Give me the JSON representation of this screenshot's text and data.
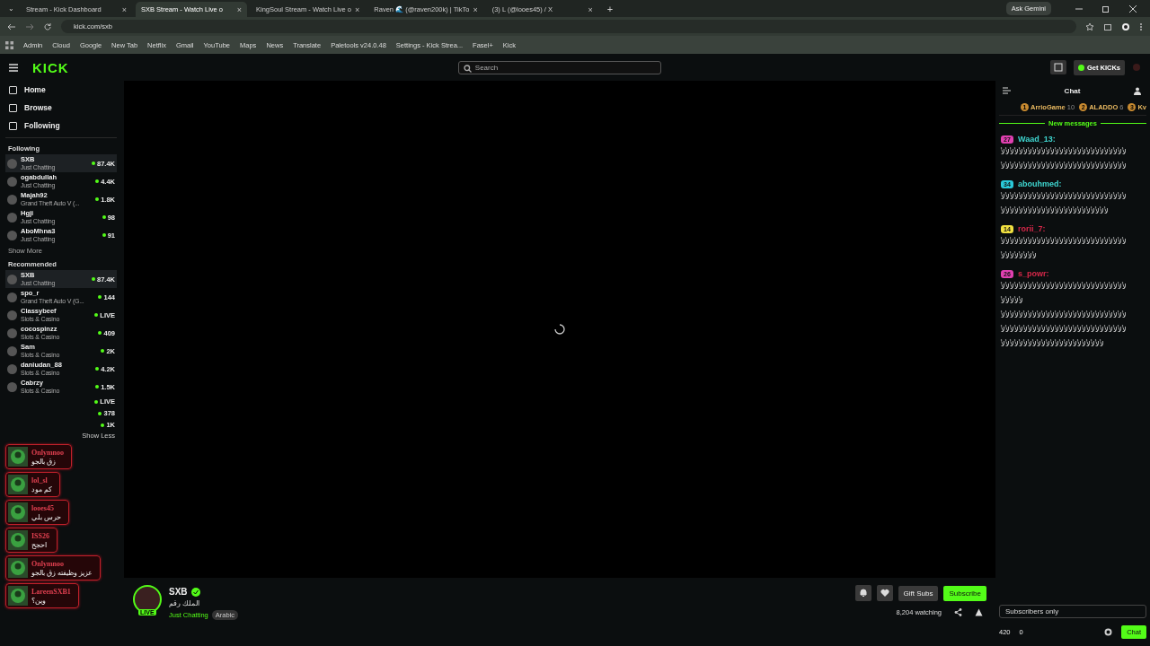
{
  "browser": {
    "tab_list": "⌄",
    "tabs": [
      {
        "title": "Stream - Kick Dashboard",
        "close": "×",
        "selected": false
      },
      {
        "title": "SXB Stream - Watch Live o",
        "close": "×",
        "selected": true
      },
      {
        "title": "KingSoul Stream - Watch Live o",
        "close": "×",
        "selected": false
      },
      {
        "title": "Raven 🌊 (@raven200k) | TikTo",
        "close": "×",
        "selected": false
      },
      {
        "title": "(3) L (@looes45) / X",
        "close": "×",
        "selected": false
      }
    ],
    "new_tab": "+",
    "ask": "Ask Gemini",
    "url": "kick.com/sxb",
    "bookmarks": [
      "Admin",
      "Cloud",
      "Google",
      "New Tab",
      "Netflix",
      "Gmail",
      "YouTube",
      "Maps",
      "News",
      "Translate",
      "Paletools v24.0.48",
      "Settings - Kick Strea...",
      "Fasel+",
      "Kick"
    ]
  },
  "header": {
    "logo": "KICK",
    "search_placeholder": "Search",
    "get_kicks": "Get KICKs"
  },
  "nav": [
    "Home",
    "Browse",
    "Following"
  ],
  "following": {
    "title": "Following",
    "channels": [
      {
        "name": "SXB",
        "category": "Just Chatting",
        "viewers": "87.4K",
        "selected": true
      },
      {
        "name": "ogabdullah",
        "category": "Just Chatting",
        "viewers": "4.4K",
        "selected": false
      },
      {
        "name": "Majah92",
        "category": "Grand Theft Auto V (...",
        "viewers": "1.8K",
        "selected": false
      },
      {
        "name": "Hgji",
        "category": "Just Chatting",
        "viewers": "98",
        "selected": false
      },
      {
        "name": "AboMhna3",
        "category": "Just Chatting",
        "viewers": "91",
        "selected": false
      }
    ],
    "show_more": "Show More"
  },
  "recommended": {
    "title": "Recommended",
    "channels": [
      {
        "name": "SXB",
        "category": "Just Chatting",
        "viewers": "87.4K",
        "selected": true
      },
      {
        "name": "spo_r",
        "category": "Grand Theft Auto V (G...",
        "viewers": "144",
        "selected": false
      },
      {
        "name": "Classybeef",
        "category": "Slots & Casino",
        "viewers": "LIVE",
        "selected": false
      },
      {
        "name": "cocospinzz",
        "category": "Slots & Casino",
        "viewers": "409",
        "selected": false
      },
      {
        "name": "Sam",
        "category": "Slots & Casino",
        "viewers": "2K",
        "selected": false
      },
      {
        "name": "daniudan_88",
        "category": "Slots & Casino",
        "viewers": "4.2K",
        "selected": false
      },
      {
        "name": "Cabrzy",
        "category": "Slots & Casino",
        "viewers": "1.5K",
        "selected": false
      }
    ],
    "covered_viewers": [
      "LIVE",
      "378",
      "1K"
    ],
    "show_less": "Show Less"
  },
  "notifications": [
    {
      "name": "Onlymnoo",
      "message": "زق بالجو"
    },
    {
      "name": "lol_sl",
      "message": "كم مود"
    },
    {
      "name": "looes45",
      "message": "حرس بلي"
    },
    {
      "name": "ISS26",
      "message": "احجح"
    },
    {
      "name": "Onlymnoo",
      "message": "عزيز وظيفته زق بالجو"
    },
    {
      "name": "LareenSXB1",
      "message": "وين؟"
    }
  ],
  "chat": {
    "title": "Chat",
    "leaders": [
      {
        "rank": "1",
        "name": "ArrioGame",
        "count": "10"
      },
      {
        "rank": "2",
        "name": "ALADDO",
        "count": "6"
      },
      {
        "rank": "3",
        "name": "Kv"
      }
    ],
    "new_messages": "New messages",
    "messages": [
      {
        "badge": {
          "text": "27",
          "color": "#e040b0"
        },
        "user": {
          "name": "Waad_13:",
          "color": "#3fd6d0"
        },
        "lines": [
          "ﻷﻷﻷﻷﻷﻷﻷﻷﻷﻷﻷﻷﻷﻷﻷﻷﻷﻷﻷﻷﻷﻷﻷﻷﻷﻷﻷﻷ",
          "ﻷﻷﻷﻷﻷﻷﻷﻷﻷﻷﻷﻷﻷﻷﻷﻷﻷﻷﻷﻷﻷﻷﻷﻷﻷﻷﻷﻷ"
        ]
      },
      {
        "badge": {
          "text": "34",
          "color": "#2ac8d8"
        },
        "user": {
          "name": "abouhmed:",
          "color": "#3fd6d0"
        },
        "lines": [
          "ﻷﻷﻷﻷﻷﻷﻷﻷﻷﻷﻷﻷﻷﻷﻷﻷﻷﻷﻷﻷﻷﻷﻷﻷﻷﻷﻷﻷ",
          "ﻷﻷﻷﻷﻷﻷﻷﻷﻷﻷﻷﻷﻷﻷﻷﻷﻷﻷﻷﻷﻷﻷﻷﻷ"
        ]
      },
      {
        "badge": {
          "text": "14",
          "color": "#f0e040"
        },
        "user": {
          "name": "rorii_7:",
          "color": "#d8284a"
        },
        "lines": [
          "ﻷﻷﻷﻷﻷﻷﻷﻷﻷﻷﻷﻷﻷﻷﻷﻷﻷﻷﻷﻷﻷﻷﻷﻷﻷﻷﻷﻷ",
          "ﻷﻷﻷﻷﻷﻷﻷﻷ"
        ]
      },
      {
        "badge": {
          "text": "26",
          "color": "#e040b0"
        },
        "user": {
          "name": "s_powr:",
          "color": "#d8284a"
        },
        "lines": [
          "ﻷﻷﻷﻷﻷﻷﻷﻷﻷﻷﻷﻷﻷﻷﻷﻷﻷﻷﻷﻷﻷﻷﻷﻷﻷﻷﻷﻷ",
          "ﻷﻷﻷﻷﻷ",
          "ﻷﻷﻷﻷﻷﻷﻷﻷﻷﻷﻷﻷﻷﻷﻷﻷﻷﻷﻷﻷﻷﻷﻷﻷﻷﻷﻷﻷ",
          "ﻷﻷﻷﻷﻷﻷﻷﻷﻷﻷﻷﻷﻷﻷﻷﻷﻷﻷﻷﻷﻷﻷﻷﻷﻷﻷﻷﻷ",
          "ﻷﻷﻷﻷﻷﻷﻷﻷﻷﻷﻷﻷﻷﻷﻷﻷﻷﻷﻷﻷﻷﻷﻷ"
        ]
      }
    ],
    "input_placeholder": "Subscribers only",
    "points": "420",
    "kicks": "0",
    "send": "Chat"
  },
  "stream": {
    "name": "SXB",
    "live": "LIVE",
    "title": "الملك رقم",
    "category": "Just Chatting",
    "tag": "Arabic",
    "gift": "Gift Subs",
    "subscribe": "Subscribe",
    "viewers": "8,204",
    "watching": "watching"
  }
}
